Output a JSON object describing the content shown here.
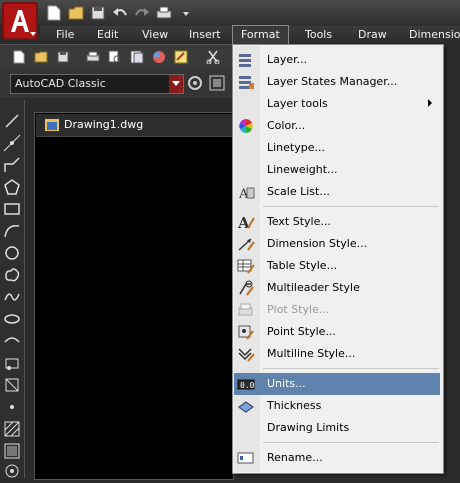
{
  "app": {
    "menubar": [
      "File",
      "Edit",
      "View",
      "Insert",
      "Format",
      "Tools",
      "Draw",
      "Dimension"
    ],
    "workspace": "AutoCAD Classic",
    "document_tab": "Drawing1.dwg"
  },
  "format_menu": {
    "items": [
      {
        "label": "Layer...",
        "icon": "layer-icon"
      },
      {
        "label": "Layer States Manager...",
        "icon": "layer-states-icon"
      },
      {
        "label": "Layer tools",
        "icon": "",
        "submenu": true
      },
      {
        "label": "Color...",
        "icon": "color-wheel-icon"
      },
      {
        "label": "Linetype...",
        "icon": ""
      },
      {
        "label": "Lineweight...",
        "icon": ""
      },
      {
        "label": "Scale List...",
        "icon": "scale-list-icon"
      },
      {
        "label": "Text Style...",
        "icon": "text-style-icon"
      },
      {
        "label": "Dimension Style...",
        "icon": "dimension-style-icon"
      },
      {
        "label": "Table Style...",
        "icon": "table-style-icon"
      },
      {
        "label": "Multileader Style",
        "icon": "multileader-style-icon"
      },
      {
        "label": "Plot Style...",
        "icon": "plot-style-icon",
        "disabled": true
      },
      {
        "label": "Point Style...",
        "icon": "point-style-icon"
      },
      {
        "label": "Multiline Style...",
        "icon": "multiline-style-icon"
      },
      {
        "label": "Units...",
        "icon": "units-icon",
        "selected": true
      },
      {
        "label": "Thickness",
        "icon": "thickness-icon"
      },
      {
        "label": "Drawing Limits",
        "icon": ""
      },
      {
        "label": "Rename...",
        "icon": "rename-icon"
      }
    ]
  }
}
